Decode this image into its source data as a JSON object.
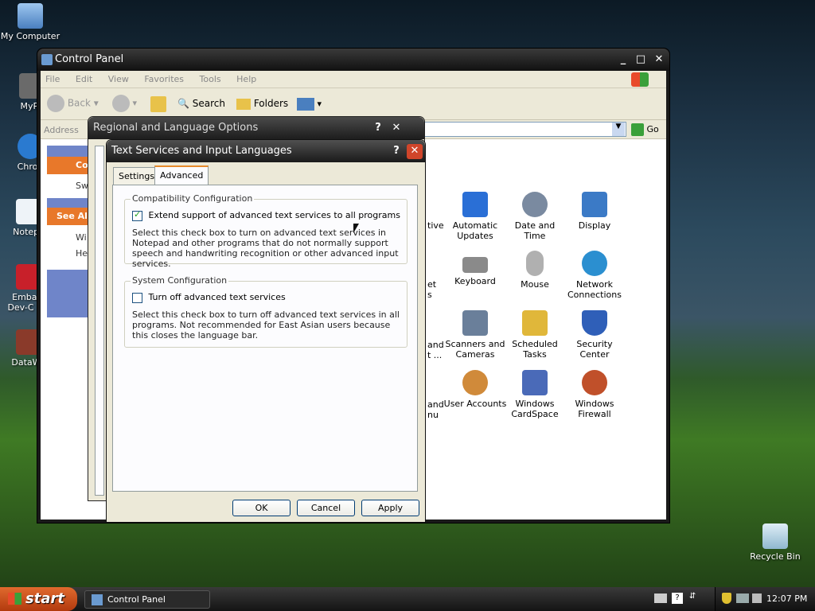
{
  "desktop_icons": [
    {
      "label": "My Computer",
      "x": 0
    },
    {
      "label": "MyPa",
      "x": 0
    },
    {
      "label": "Chron",
      "x": 0
    },
    {
      "label": "Notepa",
      "x": 0
    },
    {
      "label": "Embarc Dev-C",
      "x": 0
    },
    {
      "label": "DataWa",
      "x": 0
    },
    {
      "label": "Recycle Bin",
      "x": 0
    }
  ],
  "control_panel": {
    "title": "Control Panel",
    "menu": [
      "File",
      "Edit",
      "View",
      "Favorites",
      "Tools",
      "Help"
    ],
    "toolbar": {
      "back": "Back",
      "search": "Search",
      "folders": "Folders"
    },
    "address_label": "Address",
    "go_label": "Go",
    "left_pane": {
      "header1": "Co",
      "item1": "Sw",
      "header2": "See Al",
      "items": [
        "Wi",
        "He"
      ]
    },
    "partial_labels": [
      "tive",
      "et",
      "s",
      "and",
      "t ...",
      "and",
      "nu"
    ],
    "items": [
      {
        "label": "Automatic Updates",
        "color": "#2a6fd6"
      },
      {
        "label": "Date and Time",
        "color": "#7a8aa0"
      },
      {
        "label": "Display",
        "color": "#3b7ac6"
      },
      {
        "label": "Keyboard",
        "color": "#8a8a8a"
      },
      {
        "label": "Mouse",
        "color": "#b0b0b0"
      },
      {
        "label": "Network Connections",
        "color": "#2b8fd0"
      },
      {
        "label": "Scanners and Cameras",
        "color": "#6a7f9a"
      },
      {
        "label": "Scheduled Tasks",
        "color": "#e0b73a"
      },
      {
        "label": "Security Center",
        "color": "#2f5fb8"
      },
      {
        "label": "User Accounts",
        "color": "#d08a3a"
      },
      {
        "label": "Windows CardSpace",
        "color": "#4a6ab8"
      },
      {
        "label": "Windows Firewall",
        "color": "#c0502a"
      }
    ]
  },
  "regional_dialog": {
    "title": "Regional and Language Options",
    "help": "?",
    "close": "✕"
  },
  "text_services_dialog": {
    "title": "Text Services and Input Languages",
    "help": "?",
    "close": "✕",
    "tabs": [
      "Settings",
      "Advanced"
    ],
    "compat_group": {
      "title": "Compatibility Configuration",
      "checkbox_label": "Extend support of advanced text services to all programs",
      "checked": true,
      "description": "Select this check box to turn on advanced text services in Notepad and other programs that do not normally support speech and handwriting recognition or other advanced input services."
    },
    "system_group": {
      "title": "System Configuration",
      "checkbox_label": "Turn off advanced text services",
      "checked": false,
      "description": "Select this check box to turn off advanced text services in all programs. Not recommended for East Asian users because this closes the language bar."
    },
    "buttons": {
      "ok": "OK",
      "cancel": "Cancel",
      "apply": "Apply"
    }
  },
  "taskbar": {
    "start": "start",
    "task": "Control Panel",
    "clock": "12:07 PM"
  }
}
